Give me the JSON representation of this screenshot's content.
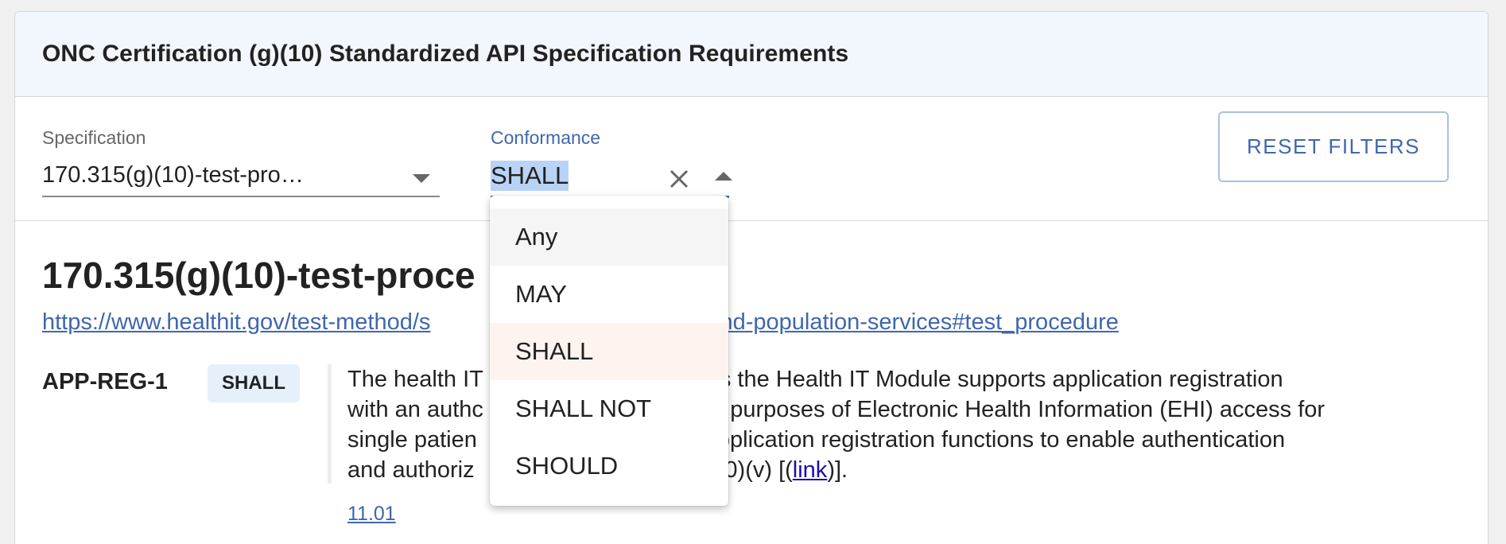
{
  "header": {
    "title": "ONC Certification (g)(10) Standardized API Specification Requirements"
  },
  "filters": {
    "specification": {
      "label": "Specification",
      "value": "170.315(g)(10)-test-pro…"
    },
    "conformance": {
      "label": "Conformance",
      "value": "SHALL",
      "options": [
        "Any",
        "MAY",
        "SHALL",
        "SHALL NOT",
        "SHOULD"
      ],
      "selected_option": "SHALL",
      "highlighted_option": "Any"
    },
    "reset_label": "RESET FILTERS"
  },
  "section": {
    "title": "170.315(g)(10)-test-proce",
    "link": "https://www.healthit.gov/test-method/s",
    "link_tail": "ent-and-population-services#test_procedure"
  },
  "requirement": {
    "id": "APP-REG-1",
    "badge": "SHALL",
    "text_lines": [
      [
        "The health IT",
        "rates the Health IT Module supports application registration"
      ],
      [
        "with an authc",
        "he purposes of Electronic Health Information (EHI) access for"
      ],
      [
        "single patien",
        " for application registration functions to enable authentication"
      ],
      [
        "and authoriz",
        "(10)(v) [("
      ]
    ],
    "link_text": "link",
    "text_end": ")].",
    "version": "11.01"
  },
  "colors": {
    "accent": "#3f67ad",
    "header_bg": "#f2f6fd",
    "badge_bg": "#e6f0fb",
    "selection_bg": "#b9d3f6"
  }
}
